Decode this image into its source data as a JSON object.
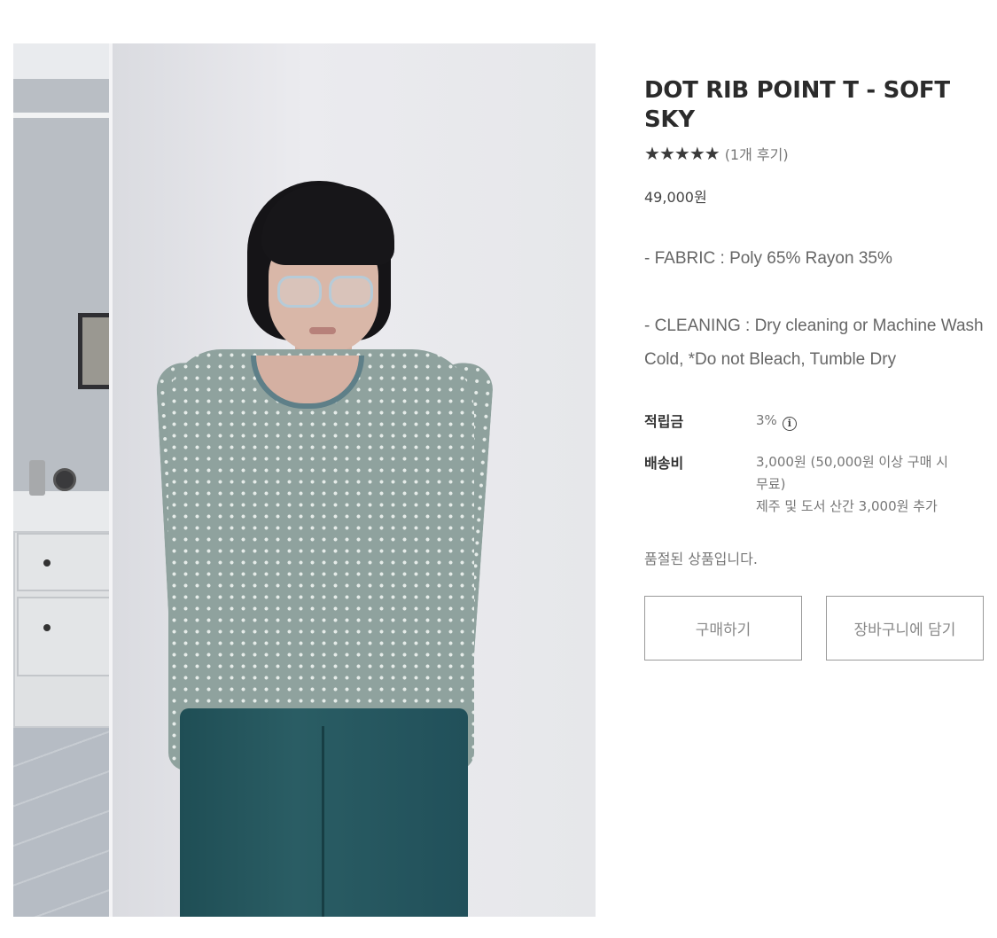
{
  "product": {
    "title": "DOT RIB POINT T - SOFT SKY",
    "rating": {
      "stars": 5,
      "star_icon": "star-icon",
      "review_count_text": "(1개 후기)"
    },
    "price": "49,000원",
    "description": {
      "fabric": "- FABRIC : Poly 65% Rayon 35%",
      "cleaning_line1": "- CLEANING : Dry cleaning or Machine Wash",
      "cleaning_line2": "Cold, *Do not Bleach, Tumble Dry"
    }
  },
  "points": {
    "label": "적립금",
    "value": "3%",
    "info_icon": "info-icon"
  },
  "shipping": {
    "label": "배송비",
    "line1": "3,000원 (50,000원 이상 구매 시",
    "line2": "무료)",
    "line3": "제주 및 도서 산간 3,000원 추가"
  },
  "status": {
    "soldout_text": "품절된 상품입니다."
  },
  "actions": {
    "buy_label": "구매하기",
    "cart_label": "장바구니에 담기"
  },
  "colors": {
    "text_dark": "#2b2b2b",
    "text_muted": "#777777",
    "button_border": "#9a9a9a",
    "shirt": "#8fa29e",
    "pants": "#2a5d64"
  }
}
